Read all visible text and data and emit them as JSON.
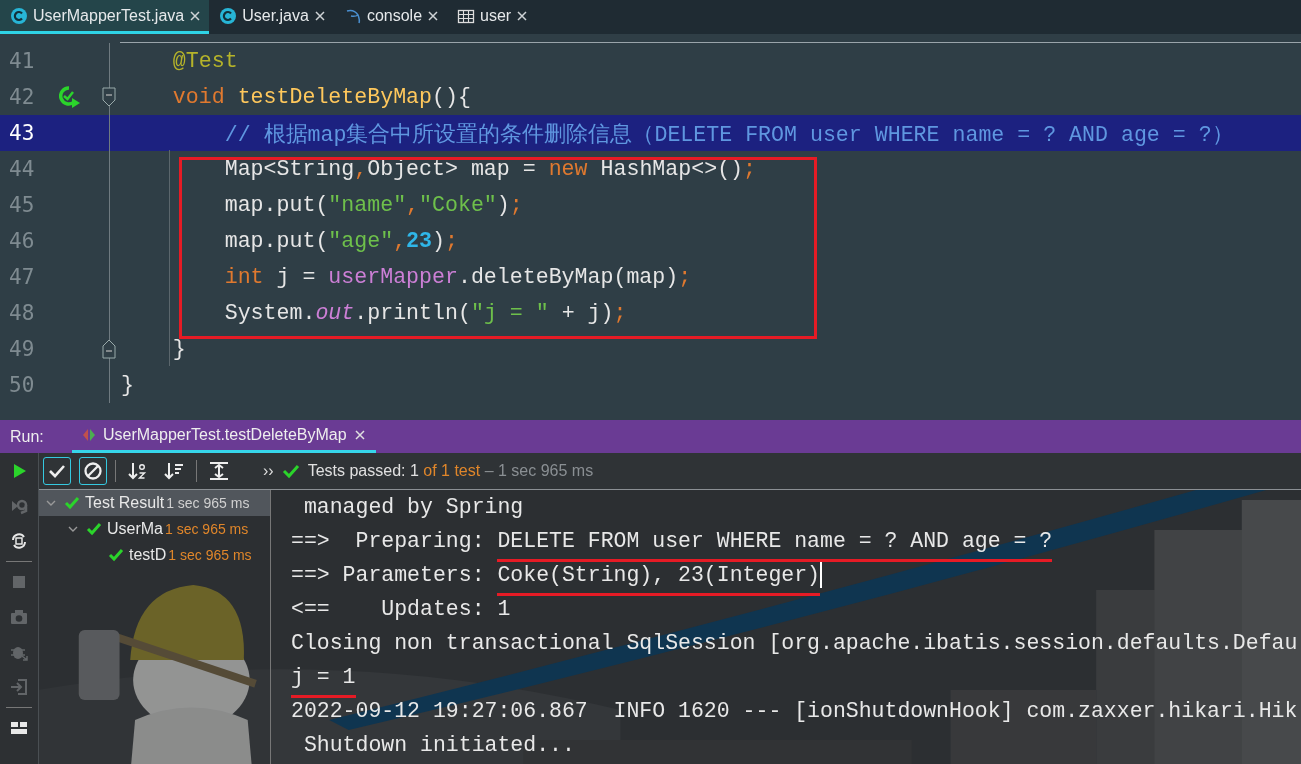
{
  "editor_tabs": [
    {
      "label": "UserMapperTest.java",
      "kind": "class",
      "selected": true
    },
    {
      "label": "User.java",
      "kind": "class",
      "selected": false
    },
    {
      "label": "console",
      "kind": "database",
      "selected": false
    },
    {
      "label": "user",
      "kind": "table",
      "selected": false
    }
  ],
  "code_lines": [
    {
      "number": "41",
      "current": false,
      "tokens": [
        {
          "text": "    @Test",
          "kind": "annotation"
        }
      ]
    },
    {
      "number": "42",
      "current": false,
      "run_marker": true,
      "fold_open": true,
      "tokens": [
        {
          "text": "    void ",
          "kind": "keyword"
        },
        {
          "text": "testDeleteByMap",
          "kind": "method"
        },
        {
          "text": "(){",
          "kind": "plain"
        }
      ]
    },
    {
      "number": "43",
      "current": true,
      "tokens": [
        {
          "text": "        // 根据map集合中所设置的条件删除信息（DELETE FROM user WHERE name = ? AND age = ?）",
          "kind": "comment"
        }
      ]
    },
    {
      "number": "44",
      "current": false,
      "boxed": true,
      "tokens": [
        {
          "text": "        Map<String",
          "kind": "plain"
        },
        {
          "text": ",",
          "kind": "punct"
        },
        {
          "text": "Object> map = ",
          "kind": "plain"
        },
        {
          "text": "new",
          "kind": "keyword"
        },
        {
          "text": " HashMap<>()",
          "kind": "plain"
        },
        {
          "text": ";",
          "kind": "punct"
        }
      ]
    },
    {
      "number": "45",
      "current": false,
      "boxed": true,
      "tokens": [
        {
          "text": "        map.put(",
          "kind": "plain"
        },
        {
          "text": "\"name\"",
          "kind": "string"
        },
        {
          "text": ",",
          "kind": "punct"
        },
        {
          "text": "\"Coke\"",
          "kind": "string"
        },
        {
          "text": ")",
          "kind": "plain"
        },
        {
          "text": ";",
          "kind": "punct"
        }
      ]
    },
    {
      "number": "46",
      "current": false,
      "boxed": true,
      "tokens": [
        {
          "text": "        map.put(",
          "kind": "plain"
        },
        {
          "text": "\"age\"",
          "kind": "string"
        },
        {
          "text": ",",
          "kind": "punct"
        },
        {
          "text": "23",
          "kind": "number"
        },
        {
          "text": ")",
          "kind": "plain"
        },
        {
          "text": ";",
          "kind": "punct"
        }
      ]
    },
    {
      "number": "47",
      "current": false,
      "boxed": true,
      "tokens": [
        {
          "text": "        int",
          "kind": "keyword"
        },
        {
          "text": " j = ",
          "kind": "plain"
        },
        {
          "text": "userMapper",
          "kind": "field"
        },
        {
          "text": ".deleteByMap(map)",
          "kind": "plain"
        },
        {
          "text": ";",
          "kind": "punct"
        }
      ]
    },
    {
      "number": "48",
      "current": false,
      "boxed": true,
      "tokens": [
        {
          "text": "        System.",
          "kind": "plain"
        },
        {
          "text": "out",
          "kind": "static"
        },
        {
          "text": ".println(",
          "kind": "plain"
        },
        {
          "text": "\"j = \"",
          "kind": "string"
        },
        {
          "text": " + j)",
          "kind": "plain"
        },
        {
          "text": ";",
          "kind": "punct"
        }
      ]
    },
    {
      "number": "49",
      "current": false,
      "fold_close": true,
      "tokens": [
        {
          "text": "    }",
          "kind": "plain"
        }
      ]
    },
    {
      "number": "50",
      "current": false,
      "tokens": [
        {
          "text": "}",
          "kind": "plain"
        }
      ]
    }
  ],
  "run_panel": {
    "label": "Run:",
    "tabs": [
      {
        "label": "UserMapperTest.testDeleteByMap",
        "selected": true
      }
    ],
    "side_tools": [
      {
        "kind": "run",
        "disabled": false
      },
      {
        "kind": "rerun-failed",
        "disabled": true
      },
      {
        "kind": "auto-test",
        "disabled": false
      },
      {
        "kind": "stop",
        "disabled": true
      },
      {
        "kind": "camera",
        "disabled": true
      },
      {
        "kind": "bug",
        "disabled": true
      },
      {
        "kind": "import",
        "disabled": true
      },
      {
        "kind": "layout",
        "disabled": false
      }
    ],
    "toolbar": [
      {
        "kind": "show-passed",
        "on": true
      },
      {
        "kind": "show-ignored",
        "on": true
      },
      {
        "kind": "sort-alpha",
        "on": false
      },
      {
        "kind": "sort-duration",
        "on": false
      },
      {
        "kind": "expand",
        "on": false
      }
    ],
    "more": "››",
    "status": [
      {
        "text": "Tests passed: ",
        "kind": "normal"
      },
      {
        "text": "1",
        "kind": "normal"
      },
      {
        "text": " of 1 test",
        "kind": "warn"
      },
      {
        "text": " – 1 sec 965 ms",
        "kind": "dim"
      }
    ],
    "tree": [
      {
        "label": "Test Result",
        "time": "1 sec 965 ms",
        "selected": true,
        "expanded": true,
        "children": [
          {
            "label": "UserMa",
            "time": "1 sec 965 ms",
            "selected": false,
            "expanded": true,
            "children": [
              {
                "label": "testD",
                "time": "1 sec 965 ms",
                "selected": false
              }
            ]
          }
        ]
      }
    ],
    "console": [
      {
        "segments": [
          {
            "text": " managed by Spring",
            "underlined": false
          }
        ]
      },
      {
        "segments": [
          {
            "text": "==>  Preparing: ",
            "underlined": false
          },
          {
            "text": "DELETE FROM user WHERE name = ? AND age = ?",
            "underlined": true
          }
        ]
      },
      {
        "caret": true,
        "segments": [
          {
            "text": "==> Parameters: ",
            "underlined": false
          },
          {
            "text": "Coke(String), 23(Integer)",
            "underlined": true
          }
        ]
      },
      {
        "segments": [
          {
            "text": "<==    Updates: 1",
            "underlined": false
          }
        ]
      },
      {
        "segments": [
          {
            "text": "Closing non transactional SqlSession [org.apache.ibatis.session.defaults.Defau",
            "underlined": false
          }
        ]
      },
      {
        "segments": [
          {
            "text": "j = 1",
            "underlined": true
          }
        ]
      },
      {
        "segments": [
          {
            "text": "2022-09-12 19:27:06.867  INFO 1620 --- [ionShutdownHook] com.zaxxer.hikari.Hik",
            "underlined": false
          }
        ]
      },
      {
        "segments": [
          {
            "text": " Shutdown initiated...",
            "underlined": false
          }
        ]
      }
    ]
  }
}
